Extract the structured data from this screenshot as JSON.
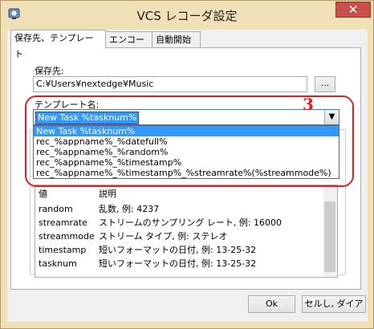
{
  "window": {
    "title": "VCS レコーダ設定",
    "close_label": "✕"
  },
  "tabs": [
    {
      "label": "保存先、テンプレート"
    },
    {
      "label": "エンコーダ"
    },
    {
      "label": "自動開始"
    }
  ],
  "save": {
    "label": "保存先:",
    "path": "C:¥Users¥nextedge¥Music",
    "browse_label": "..."
  },
  "template": {
    "label": "テンプレート名:",
    "value": "New Task %tasknum%",
    "options": [
      "New Task %tasknum%",
      "rec_%appname%_%datefull%",
      "rec_%appname%_%random%",
      "rec_%appname%_%timestamp%",
      "rec_%appname%_%timestamp%_%streamrate%(%streammode%)"
    ]
  },
  "table": {
    "header": {
      "name": "値",
      "desc": "説明"
    },
    "rows": [
      {
        "name": "random",
        "desc": "乱数, 例: 4237"
      },
      {
        "name": "streamrate",
        "desc": "ストリームのサンプリング レート, 例: 16000"
      },
      {
        "name": "streammode",
        "desc": "ストリーム タイプ, 例: ステレオ"
      },
      {
        "name": "timestamp",
        "desc": "短いフォーマットの日付, 例: 13-25-32"
      },
      {
        "name": "tasknum",
        "desc": "短いフォーマットの日付, 例: 13-25-32"
      }
    ]
  },
  "buttons": {
    "ok": "Ok",
    "cancel": "セルし, ダイア"
  },
  "annotation": {
    "number": "3"
  }
}
